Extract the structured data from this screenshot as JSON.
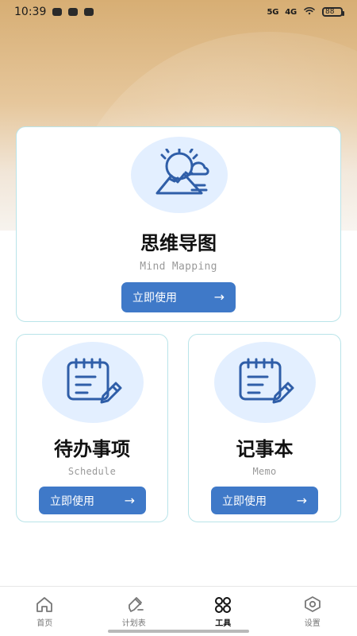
{
  "status_bar": {
    "time": "10:39",
    "network": "5G",
    "network2": "4G",
    "battery": "88"
  },
  "tools": {
    "mind_mapping": {
      "title": "思维导图",
      "subtitle": "Mind Mapping",
      "button_label": "立即使用",
      "arrow": "→"
    },
    "schedule": {
      "title": "待办事项",
      "subtitle": "Schedule",
      "button_label": "立即使用",
      "arrow": "→"
    },
    "memo": {
      "title": "记事本",
      "subtitle": "Memo",
      "button_label": "立即使用",
      "arrow": "→"
    }
  },
  "bottom_nav": [
    {
      "label": "首页",
      "icon": "home-icon",
      "active": false
    },
    {
      "label": "计划表",
      "icon": "edit-icon",
      "active": false
    },
    {
      "label": "工具",
      "icon": "tools-icon",
      "active": true
    },
    {
      "label": "设置",
      "icon": "settings-icon",
      "active": false
    }
  ],
  "colors": {
    "accent": "#3f79c8",
    "icon_bubble": "#e3efff",
    "card_border": "#b9e4e9"
  }
}
